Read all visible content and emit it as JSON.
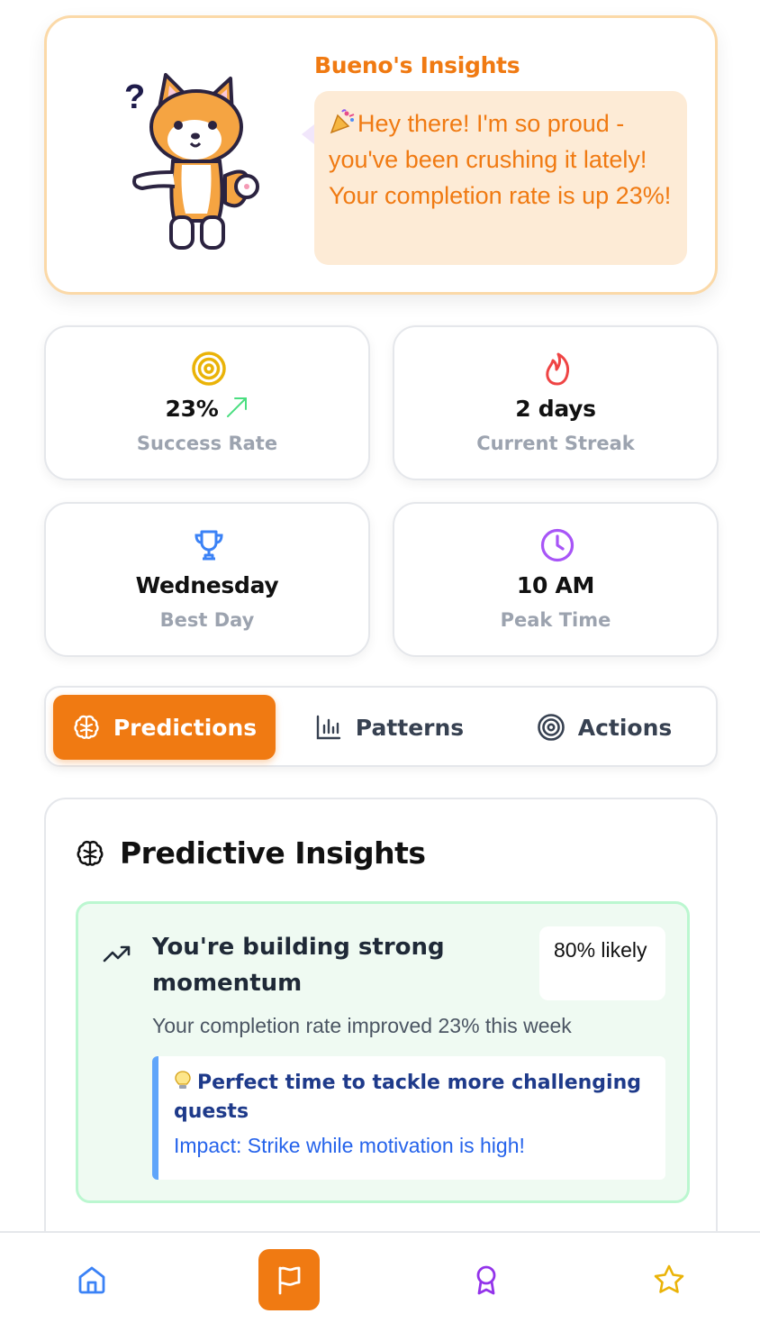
{
  "bueno": {
    "title": "Bueno's Insights",
    "message": "Hey there! I'm so proud - you've been crushing it lately! Your completion rate is up 23%!",
    "mascot_question": "?"
  },
  "stats": [
    {
      "icon": "target-icon",
      "value": "23%",
      "label": "Success Rate",
      "color": "#eab308"
    },
    {
      "icon": "flame-icon",
      "value": "2 days",
      "label": "Current Streak",
      "color": "#ef4444"
    },
    {
      "icon": "trophy-icon",
      "value": "Wednesday",
      "label": "Best Day",
      "color": "#3b82f6"
    },
    {
      "icon": "clock-icon",
      "value": "10 AM",
      "label": "Peak Time",
      "color": "#a855f7"
    }
  ],
  "tabs": [
    {
      "label": "Predictions",
      "icon": "brain-icon",
      "active": true
    },
    {
      "label": "Patterns",
      "icon": "bar-chart-icon",
      "active": false
    },
    {
      "label": "Actions",
      "icon": "target-icon",
      "active": false
    }
  ],
  "panel": {
    "title": "Predictive Insights",
    "insight": {
      "title": "You're building strong momentum",
      "likelihood": "80% likely",
      "description": "Your completion rate improved 23% this week",
      "tip": "Perfect time to tackle more challenging quests",
      "impact": "Impact: Strike while motivation is high!"
    }
  },
  "nav": [
    {
      "icon": "home-icon",
      "color": "#3b82f6"
    },
    {
      "icon": "flag-icon",
      "color": "#ffffff",
      "active": true
    },
    {
      "icon": "award-icon",
      "color": "#9333ea"
    },
    {
      "icon": "star-icon",
      "color": "#eab308"
    }
  ],
  "colors": {
    "accent": "#f07a12",
    "muted": "#9ca3af"
  }
}
